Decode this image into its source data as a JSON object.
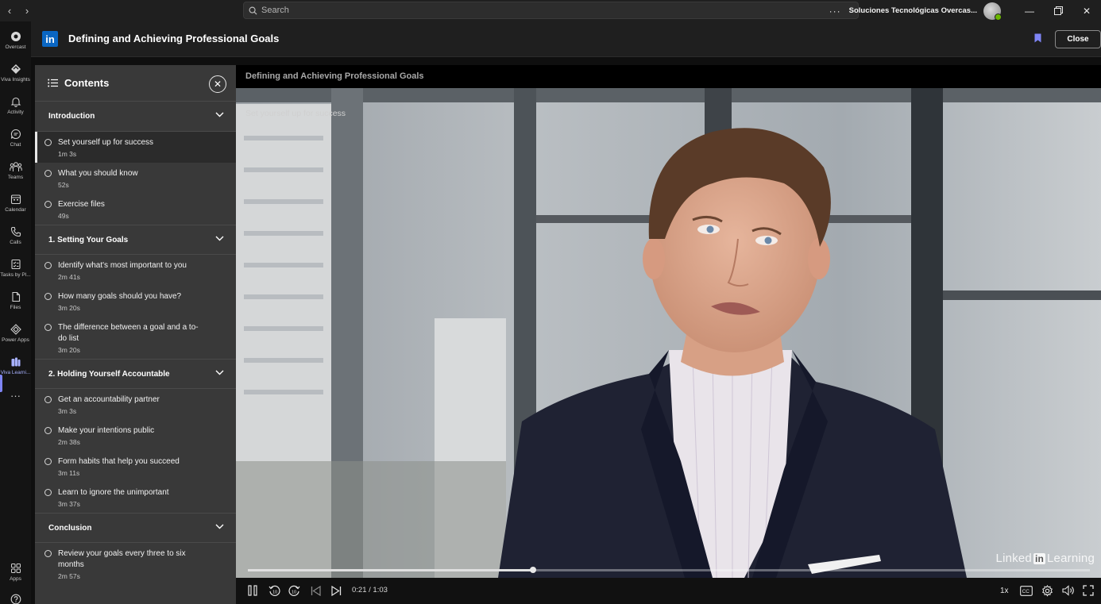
{
  "window": {
    "search_placeholder": "Search",
    "org_name": "Soluciones Tecnológicas Overcas...",
    "more_label": "···"
  },
  "rail": {
    "items": [
      {
        "label": "Overcast",
        "icon": "overcast-icon"
      },
      {
        "label": "Viva Insights",
        "icon": "insights-icon"
      },
      {
        "label": "Activity",
        "icon": "bell-icon"
      },
      {
        "label": "Chat",
        "icon": "chat-icon"
      },
      {
        "label": "Teams",
        "icon": "teams-icon"
      },
      {
        "label": "Calendar",
        "icon": "calendar-icon"
      },
      {
        "label": "Calls",
        "icon": "phone-icon"
      },
      {
        "label": "Tasks by Pl...",
        "icon": "tasks-icon"
      },
      {
        "label": "Files",
        "icon": "file-icon"
      },
      {
        "label": "Power Apps",
        "icon": "power-apps-icon"
      },
      {
        "label": "Viva Learni...",
        "icon": "learning-icon"
      }
    ],
    "more": "···",
    "apps_label": "Apps"
  },
  "header": {
    "logo_text": "in",
    "title": "Defining and Achieving Professional Goals",
    "close_label": "Close"
  },
  "contents": {
    "title": "Contents",
    "sections": [
      {
        "title": "Introduction",
        "items": [
          {
            "title": "Set yourself up for success",
            "duration": "1m 3s",
            "active": true
          },
          {
            "title": "What you should know",
            "duration": "52s"
          },
          {
            "title": "Exercise files",
            "duration": "49s"
          }
        ]
      },
      {
        "title": "1. Setting Your Goals",
        "items": [
          {
            "title": "Identify what's most important to you",
            "duration": "2m 41s"
          },
          {
            "title": "How many goals should you have?",
            "duration": "3m 20s"
          },
          {
            "title": "The difference between a goal and a to-do list",
            "duration": "3m 20s"
          }
        ]
      },
      {
        "title": "2. Holding Yourself Accountable",
        "items": [
          {
            "title": "Get an accountability partner",
            "duration": "3m 3s"
          },
          {
            "title": "Make your intentions public",
            "duration": "2m 38s"
          },
          {
            "title": "Form habits that help you succeed",
            "duration": "3m 11s"
          },
          {
            "title": "Learn to ignore the unimportant",
            "duration": "3m 37s"
          }
        ]
      },
      {
        "title": "Conclusion",
        "items": [
          {
            "title": "Review your goals every three to six months",
            "duration": "2m 57s"
          }
        ]
      }
    ]
  },
  "video": {
    "course_title": "Defining and Achieving Professional Goals",
    "video_title": "Set yourself up for success",
    "watermark_pre": "Linked",
    "watermark_in": "in",
    "watermark_post": "Learning",
    "time": "0:21 / 1:03",
    "progress_fraction": 0.339,
    "speed": "1x",
    "cc": "CC"
  }
}
